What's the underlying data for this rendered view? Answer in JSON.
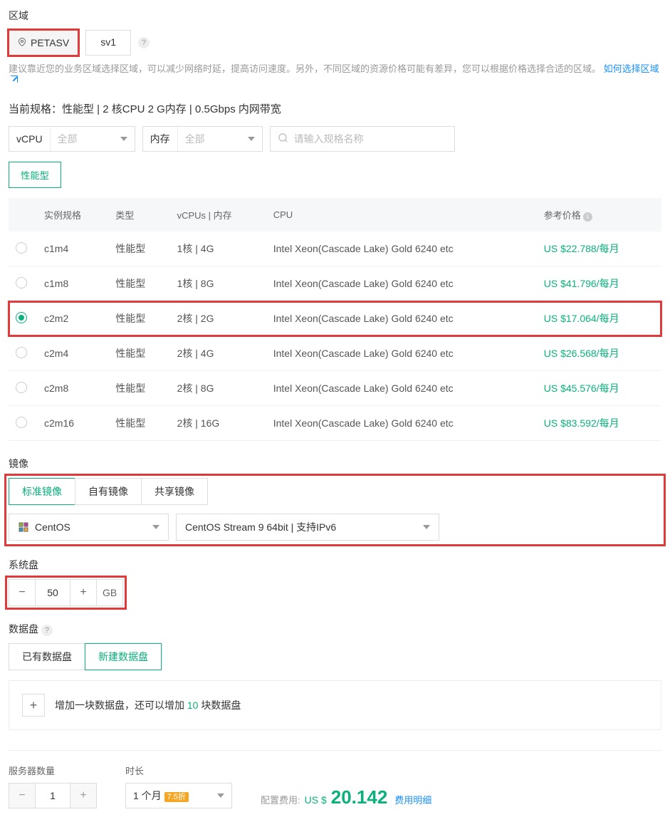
{
  "region": {
    "title": "区域",
    "selected": "PETASV",
    "alt": "sv1",
    "hint_text": "建议靠近您的业务区域选择区域，可以减少网络时延，提高访问速度。另外，不同区域的资源价格可能有差异，您可以根据价格选择合适的区域。",
    "hint_link": "如何选择区域"
  },
  "spec": {
    "title": "当前规格：性能型 | 2 核CPU 2 G内存 | 0.5Gbps 内网带宽",
    "vcpu_label": "vCPU",
    "vcpu_value": "全部",
    "mem_label": "内存",
    "mem_value": "全部",
    "search_placeholder": "请输入规格名称",
    "type_tag": "性能型",
    "headers": {
      "name": "实例规格",
      "type": "类型",
      "vcpu": "vCPUs | 内存",
      "cpu": "CPU",
      "price": "参考价格"
    },
    "rows": [
      {
        "name": "c1m4",
        "type": "性能型",
        "vcpu": "1核 | 4G",
        "cpu": "Intel Xeon(Cascade Lake) Gold 6240 etc",
        "price": "US $22.788/每月",
        "selected": false
      },
      {
        "name": "c1m8",
        "type": "性能型",
        "vcpu": "1核 | 8G",
        "cpu": "Intel Xeon(Cascade Lake) Gold 6240 etc",
        "price": "US $41.796/每月",
        "selected": false
      },
      {
        "name": "c2m2",
        "type": "性能型",
        "vcpu": "2核 | 2G",
        "cpu": "Intel Xeon(Cascade Lake) Gold 6240 etc",
        "price": "US $17.064/每月",
        "selected": true
      },
      {
        "name": "c2m4",
        "type": "性能型",
        "vcpu": "2核 | 4G",
        "cpu": "Intel Xeon(Cascade Lake) Gold 6240 etc",
        "price": "US $26.568/每月",
        "selected": false
      },
      {
        "name": "c2m8",
        "type": "性能型",
        "vcpu": "2核 | 8G",
        "cpu": "Intel Xeon(Cascade Lake) Gold 6240 etc",
        "price": "US $45.576/每月",
        "selected": false
      },
      {
        "name": "c2m16",
        "type": "性能型",
        "vcpu": "2核 | 16G",
        "cpu": "Intel Xeon(Cascade Lake) Gold 6240 etc",
        "price": "US $83.592/每月",
        "selected": false
      }
    ]
  },
  "image": {
    "title": "镜像",
    "tabs": [
      "标准镜像",
      "自有镜像",
      "共享镜像"
    ],
    "os": "CentOS",
    "version": "CentOS Stream 9 64bit | 支持IPv6"
  },
  "sysdisk": {
    "title": "系统盘",
    "value": "50",
    "unit": "GB"
  },
  "datadisk": {
    "title": "数据盘",
    "tabs": [
      "已有数据盘",
      "新建数据盘"
    ],
    "add_prefix": "增加一块数据盘，还可以增加 ",
    "add_count": "10",
    "add_suffix": " 块数据盘"
  },
  "footer": {
    "qty_label": "服务器数量",
    "qty_value": "1",
    "duration_label": "时长",
    "duration_value": "1 个月",
    "discount": "7.5折",
    "cost_label": "配置费用:",
    "currency": "US $",
    "amount": "20.142",
    "detail": "费用明细"
  }
}
